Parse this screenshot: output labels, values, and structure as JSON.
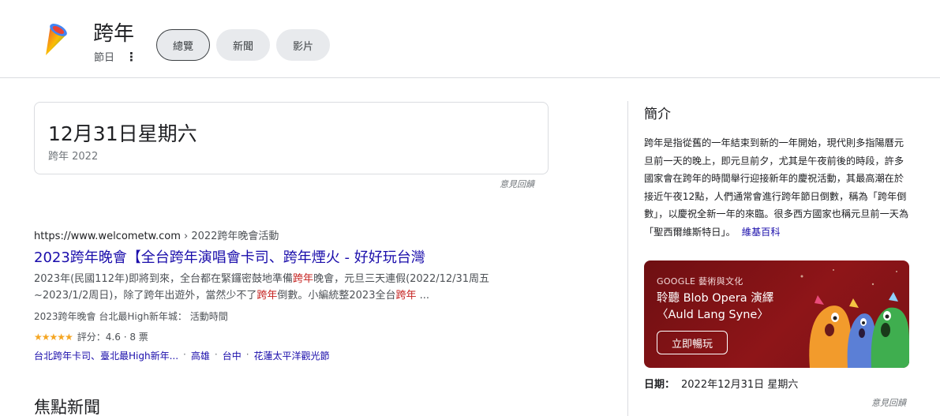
{
  "header": {
    "title": "跨年",
    "subtitle": "節日",
    "kebab": "⋮",
    "tabs": [
      {
        "label": "總覽"
      },
      {
        "label": "新聞"
      },
      {
        "label": "影片"
      }
    ]
  },
  "date_card": {
    "date": "12月31日星期六",
    "caption": "跨年 2022",
    "feedback": "意見回饋"
  },
  "result": {
    "url": "https://www.welcometw.com",
    "breadcrumb": " › 2022跨年晚會活動",
    "title": "2023跨年晚會【全台跨年演唱會卡司、跨年煙火 - 好好玩台灣",
    "snippet_parts": {
      "p1": "2023年(民國112年)即將到來，全台都在緊鑼密鼓地準備",
      "h1": "跨年",
      "p2": "晚會，元旦三天連假(2022/12/31周五 ~2023/1/2周日)，除了跨年",
      "p2b": "出遊外，當然少不了",
      "h2": "跨年",
      "p3": "倒數。小編統整2023全台",
      "h3": "跨年",
      "p4": " ..."
    },
    "meta": "2023跨年晚會 台北最High新年城： 活動時間",
    "rating_stars": "★★★★★",
    "rating_text": "評分：4.6 · 8 票",
    "sitelinks": [
      "台北跨年卡司、臺北最High新年...",
      "高雄",
      "台中",
      "花蓮太平洋觀光節"
    ],
    "sitelink_sep": "·"
  },
  "news_heading": "焦點新聞",
  "panel": {
    "intro_heading": "簡介",
    "intro_text": "跨年是指從舊的一年結束到新的一年開始，現代則多指陽曆元旦前一天的晚上，即元旦前夕，尤其是午夜前後的時段，許多國家會在跨年的時間舉行迎接新年的慶祝活動，其最高潮在於接近午夜12點，人們通常會進行跨年節日倒數，稱為「跨年倒數」，以慶祝全新一年的來臨。很多西方國家也稱元旦前一天為「聖西爾維斯特日」。",
    "intro_source": "維基百科",
    "banner": {
      "sub": "GOOGLE 藝術與文化",
      "title_line1": "聆聽 Blob Opera 演繹",
      "title_line2": "〈Auld Lang Syne〉",
      "button": "立即暢玩"
    },
    "date_label": "日期：",
    "date_value": "2022年12月31日 星期六",
    "feedback": "意見回饋"
  },
  "colors": {
    "link": "#1a0dab",
    "highlight": "#c5221f",
    "banner_bg": "#8e1518",
    "star": "#f5a623"
  }
}
